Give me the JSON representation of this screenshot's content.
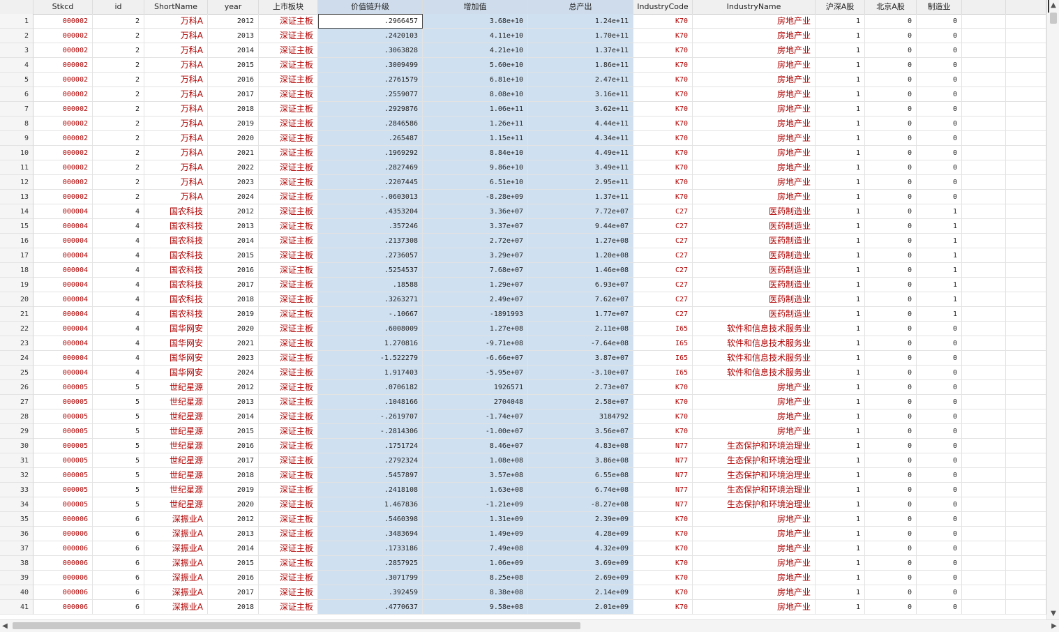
{
  "columns": [
    "Stkcd",
    "id",
    "ShortName",
    "year",
    "上市板块",
    "价值链升级",
    "增加值",
    "总产出",
    "IndustryCode",
    "IndustryName",
    "沪深A股",
    "北京A股",
    "制造业"
  ],
  "rows": [
    [
      "1",
      "000002",
      "2",
      "万科A",
      "2012",
      "深证主板",
      ".2966457",
      "3.68e+10",
      "1.24e+11",
      "K70",
      "房地产业",
      "1",
      "0",
      "0"
    ],
    [
      "2",
      "000002",
      "2",
      "万科A",
      "2013",
      "深证主板",
      ".2420103",
      "4.11e+10",
      "1.70e+11",
      "K70",
      "房地产业",
      "1",
      "0",
      "0"
    ],
    [
      "3",
      "000002",
      "2",
      "万科A",
      "2014",
      "深证主板",
      ".3063828",
      "4.21e+10",
      "1.37e+11",
      "K70",
      "房地产业",
      "1",
      "0",
      "0"
    ],
    [
      "4",
      "000002",
      "2",
      "万科A",
      "2015",
      "深证主板",
      ".3009499",
      "5.60e+10",
      "1.86e+11",
      "K70",
      "房地产业",
      "1",
      "0",
      "0"
    ],
    [
      "5",
      "000002",
      "2",
      "万科A",
      "2016",
      "深证主板",
      ".2761579",
      "6.81e+10",
      "2.47e+11",
      "K70",
      "房地产业",
      "1",
      "0",
      "0"
    ],
    [
      "6",
      "000002",
      "2",
      "万科A",
      "2017",
      "深证主板",
      ".2559077",
      "8.08e+10",
      "3.16e+11",
      "K70",
      "房地产业",
      "1",
      "0",
      "0"
    ],
    [
      "7",
      "000002",
      "2",
      "万科A",
      "2018",
      "深证主板",
      ".2929876",
      "1.06e+11",
      "3.62e+11",
      "K70",
      "房地产业",
      "1",
      "0",
      "0"
    ],
    [
      "8",
      "000002",
      "2",
      "万科A",
      "2019",
      "深证主板",
      ".2846586",
      "1.26e+11",
      "4.44e+11",
      "K70",
      "房地产业",
      "1",
      "0",
      "0"
    ],
    [
      "9",
      "000002",
      "2",
      "万科A",
      "2020",
      "深证主板",
      ".265487",
      "1.15e+11",
      "4.34e+11",
      "K70",
      "房地产业",
      "1",
      "0",
      "0"
    ],
    [
      "10",
      "000002",
      "2",
      "万科A",
      "2021",
      "深证主板",
      ".1969292",
      "8.84e+10",
      "4.49e+11",
      "K70",
      "房地产业",
      "1",
      "0",
      "0"
    ],
    [
      "11",
      "000002",
      "2",
      "万科A",
      "2022",
      "深证主板",
      ".2827469",
      "9.86e+10",
      "3.49e+11",
      "K70",
      "房地产业",
      "1",
      "0",
      "0"
    ],
    [
      "12",
      "000002",
      "2",
      "万科A",
      "2023",
      "深证主板",
      ".2207445",
      "6.51e+10",
      "2.95e+11",
      "K70",
      "房地产业",
      "1",
      "0",
      "0"
    ],
    [
      "13",
      "000002",
      "2",
      "万科A",
      "2024",
      "深证主板",
      "-.0603013",
      "-8.28e+09",
      "1.37e+11",
      "K70",
      "房地产业",
      "1",
      "0",
      "0"
    ],
    [
      "14",
      "000004",
      "4",
      "国农科技",
      "2012",
      "深证主板",
      ".4353204",
      "3.36e+07",
      "7.72e+07",
      "C27",
      "医药制造业",
      "1",
      "0",
      "1"
    ],
    [
      "15",
      "000004",
      "4",
      "国农科技",
      "2013",
      "深证主板",
      ".357246",
      "3.37e+07",
      "9.44e+07",
      "C27",
      "医药制造业",
      "1",
      "0",
      "1"
    ],
    [
      "16",
      "000004",
      "4",
      "国农科技",
      "2014",
      "深证主板",
      ".2137308",
      "2.72e+07",
      "1.27e+08",
      "C27",
      "医药制造业",
      "1",
      "0",
      "1"
    ],
    [
      "17",
      "000004",
      "4",
      "国农科技",
      "2015",
      "深证主板",
      ".2736057",
      "3.29e+07",
      "1.20e+08",
      "C27",
      "医药制造业",
      "1",
      "0",
      "1"
    ],
    [
      "18",
      "000004",
      "4",
      "国农科技",
      "2016",
      "深证主板",
      ".5254537",
      "7.68e+07",
      "1.46e+08",
      "C27",
      "医药制造业",
      "1",
      "0",
      "1"
    ],
    [
      "19",
      "000004",
      "4",
      "国农科技",
      "2017",
      "深证主板",
      ".18588",
      "1.29e+07",
      "6.93e+07",
      "C27",
      "医药制造业",
      "1",
      "0",
      "1"
    ],
    [
      "20",
      "000004",
      "4",
      "国农科技",
      "2018",
      "深证主板",
      ".3263271",
      "2.49e+07",
      "7.62e+07",
      "C27",
      "医药制造业",
      "1",
      "0",
      "1"
    ],
    [
      "21",
      "000004",
      "4",
      "国农科技",
      "2019",
      "深证主板",
      "-.10667",
      "-1891993",
      "1.77e+07",
      "C27",
      "医药制造业",
      "1",
      "0",
      "1"
    ],
    [
      "22",
      "000004",
      "4",
      "国华网安",
      "2020",
      "深证主板",
      ".6008009",
      "1.27e+08",
      "2.11e+08",
      "I65",
      "软件和信息技术服务业",
      "1",
      "0",
      "0"
    ],
    [
      "23",
      "000004",
      "4",
      "国华网安",
      "2021",
      "深证主板",
      "1.270816",
      "-9.71e+08",
      "-7.64e+08",
      "I65",
      "软件和信息技术服务业",
      "1",
      "0",
      "0"
    ],
    [
      "24",
      "000004",
      "4",
      "国华网安",
      "2023",
      "深证主板",
      "-1.522279",
      "-6.66e+07",
      "3.87e+07",
      "I65",
      "软件和信息技术服务业",
      "1",
      "0",
      "0"
    ],
    [
      "25",
      "000004",
      "4",
      "国华网安",
      "2024",
      "深证主板",
      "1.917403",
      "-5.95e+07",
      "-3.10e+07",
      "I65",
      "软件和信息技术服务业",
      "1",
      "0",
      "0"
    ],
    [
      "26",
      "000005",
      "5",
      "世纪星源",
      "2012",
      "深证主板",
      ".0706182",
      "1926571",
      "2.73e+07",
      "K70",
      "房地产业",
      "1",
      "0",
      "0"
    ],
    [
      "27",
      "000005",
      "5",
      "世纪星源",
      "2013",
      "深证主板",
      ".1048166",
      "2704048",
      "2.58e+07",
      "K70",
      "房地产业",
      "1",
      "0",
      "0"
    ],
    [
      "28",
      "000005",
      "5",
      "世纪星源",
      "2014",
      "深证主板",
      "-.2619707",
      "-1.74e+07",
      "3184792",
      "K70",
      "房地产业",
      "1",
      "0",
      "0"
    ],
    [
      "29",
      "000005",
      "5",
      "世纪星源",
      "2015",
      "深证主板",
      "-.2814306",
      "-1.00e+07",
      "3.56e+07",
      "K70",
      "房地产业",
      "1",
      "0",
      "0"
    ],
    [
      "30",
      "000005",
      "5",
      "世纪星源",
      "2016",
      "深证主板",
      ".1751724",
      "8.46e+07",
      "4.83e+08",
      "N77",
      "生态保护和环境治理业",
      "1",
      "0",
      "0"
    ],
    [
      "31",
      "000005",
      "5",
      "世纪星源",
      "2017",
      "深证主板",
      ".2792324",
      "1.08e+08",
      "3.86e+08",
      "N77",
      "生态保护和环境治理业",
      "1",
      "0",
      "0"
    ],
    [
      "32",
      "000005",
      "5",
      "世纪星源",
      "2018",
      "深证主板",
      ".5457897",
      "3.57e+08",
      "6.55e+08",
      "N77",
      "生态保护和环境治理业",
      "1",
      "0",
      "0"
    ],
    [
      "33",
      "000005",
      "5",
      "世纪星源",
      "2019",
      "深证主板",
      ".2418108",
      "1.63e+08",
      "6.74e+08",
      "N77",
      "生态保护和环境治理业",
      "1",
      "0",
      "0"
    ],
    [
      "34",
      "000005",
      "5",
      "世纪星源",
      "2020",
      "深证主板",
      "1.467836",
      "-1.21e+09",
      "-8.27e+08",
      "N77",
      "生态保护和环境治理业",
      "1",
      "0",
      "0"
    ],
    [
      "35",
      "000006",
      "6",
      "深振业A",
      "2012",
      "深证主板",
      ".5460398",
      "1.31e+09",
      "2.39e+09",
      "K70",
      "房地产业",
      "1",
      "0",
      "0"
    ],
    [
      "36",
      "000006",
      "6",
      "深振业A",
      "2013",
      "深证主板",
      ".3483694",
      "1.49e+09",
      "4.28e+09",
      "K70",
      "房地产业",
      "1",
      "0",
      "0"
    ],
    [
      "37",
      "000006",
      "6",
      "深振业A",
      "2014",
      "深证主板",
      ".1733186",
      "7.49e+08",
      "4.32e+09",
      "K70",
      "房地产业",
      "1",
      "0",
      "0"
    ],
    [
      "38",
      "000006",
      "6",
      "深振业A",
      "2015",
      "深证主板",
      ".2857925",
      "1.06e+09",
      "3.69e+09",
      "K70",
      "房地产业",
      "1",
      "0",
      "0"
    ],
    [
      "39",
      "000006",
      "6",
      "深振业A",
      "2016",
      "深证主板",
      ".3071799",
      "8.25e+08",
      "2.69e+09",
      "K70",
      "房地产业",
      "1",
      "0",
      "0"
    ],
    [
      "40",
      "000006",
      "6",
      "深振业A",
      "2017",
      "深证主板",
      ".392459",
      "8.38e+08",
      "2.14e+09",
      "K70",
      "房地产业",
      "1",
      "0",
      "0"
    ],
    [
      "41",
      "000006",
      "6",
      "深振业A",
      "2018",
      "深证主板",
      ".4770637",
      "9.58e+08",
      "2.01e+09",
      "K70",
      "房地产业",
      "1",
      "0",
      "0"
    ]
  ],
  "selected_columns": [
    5,
    6,
    7
  ],
  "active_cell": {
    "row": 0,
    "col": 5
  },
  "colors": {
    "string_text": "#b00000",
    "selection": "#cfe0f0",
    "header_selection": "#cfdceb"
  },
  "icons": {
    "scroll_up": "▲",
    "scroll_down": "▼",
    "scroll_left": "◀",
    "scroll_right": "▶"
  }
}
